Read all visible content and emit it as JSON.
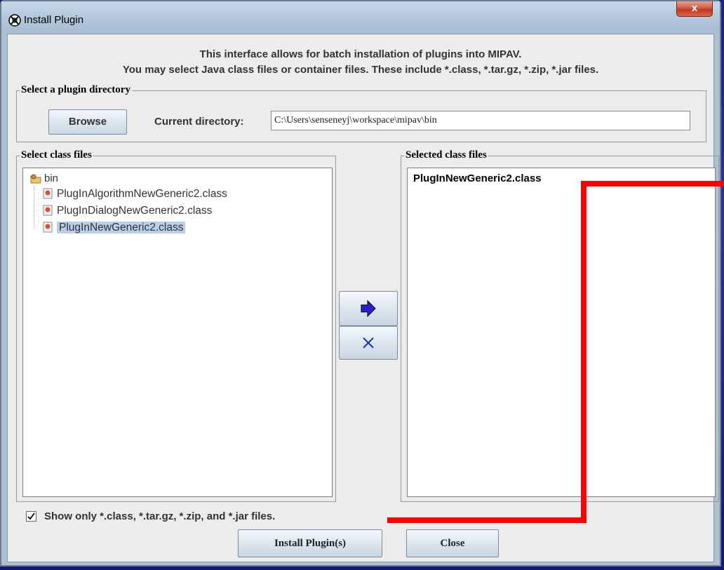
{
  "window": {
    "title": "Install Plugin",
    "close_symbol": "x"
  },
  "intro": {
    "line1": "This interface allows for batch installation of plugins into MIPAV.",
    "line2": "You may select Java class files or container files. These include *.class, *.tar.gz, *.zip, *.jar files."
  },
  "directory": {
    "group_label": "Select a plugin directory",
    "browse_label": "Browse",
    "current_label": "Current directory:",
    "current_value": "C:\\Users\\senseneyj\\workspace\\mipav\\bin"
  },
  "class_files": {
    "group_label": "Select class files",
    "root": "bin",
    "items": [
      {
        "label": "PlugInAlgorithmNewGeneric2.class"
      },
      {
        "label": "PlugInDialogNewGeneric2.class"
      },
      {
        "label": "PlugInNewGeneric2.class"
      }
    ]
  },
  "selected_files": {
    "group_label": "Selected class files",
    "items": [
      "PlugInNewGeneric2.class"
    ]
  },
  "filter": {
    "checked": true,
    "label": "Show only *.class, *.tar.gz, *.zip, and *.jar files."
  },
  "actions": {
    "install_label": "Install Plugin(s)",
    "close_label": "Close",
    "add_icon": "right-arrow-icon",
    "remove_icon": "x-remove-icon"
  },
  "colors": {
    "annotation_red": "#ff0000",
    "selection_bg": "#b8cfe6"
  }
}
